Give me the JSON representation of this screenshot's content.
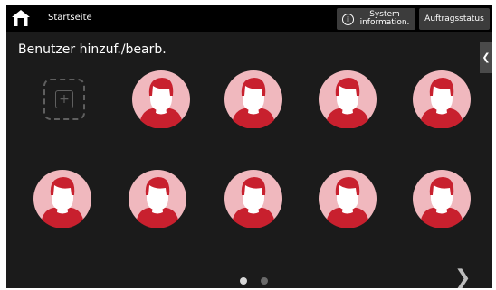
{
  "topbar": {
    "home_label": "Startseite",
    "system_info_label": "System\ninformation.",
    "job_status_label": "Auftragsstatus"
  },
  "main": {
    "title": "Benutzer hinzuf./bearb.",
    "side_tab_icon": "chevron-left-icon",
    "add_tile_icon": "add-user-plus-icon",
    "user_tile_icon": "user-avatar-icon",
    "user_tile_count": 9
  },
  "pagination": {
    "current_page": 1,
    "page_count": 2,
    "next_icon": "chevron-right-icon"
  },
  "colors": {
    "background": "#1b1b1b",
    "topbar": "#000000",
    "button": "#3c3c3c",
    "avatar_circle": "#f0b8be",
    "avatar_hair": "#c8202e",
    "avatar_face": "#ffffff"
  }
}
